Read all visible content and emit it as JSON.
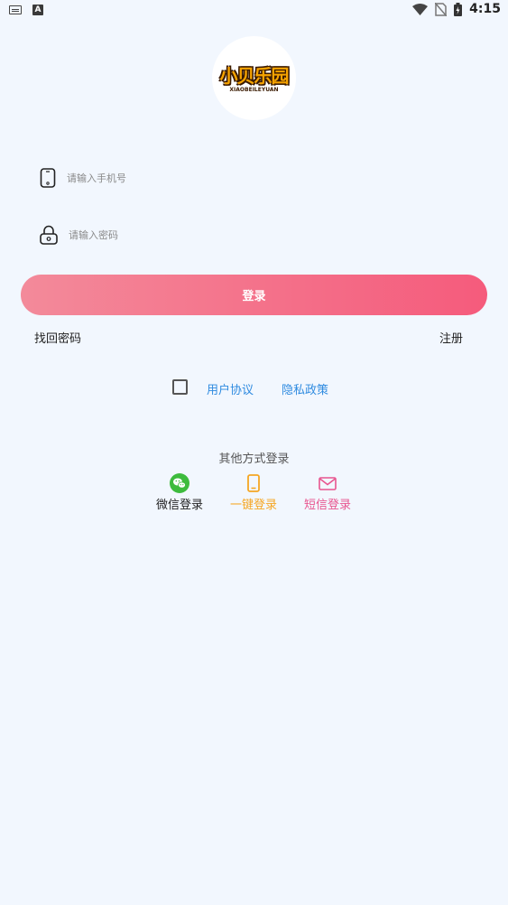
{
  "status_bar": {
    "time": "4:15",
    "left_icons": [
      "keyboard-icon",
      "a-letter-icon"
    ],
    "right_icons": [
      "wifi-icon",
      "no-sim-icon",
      "battery-icon"
    ]
  },
  "logo": {
    "main_text": "小贝乐园",
    "sub_text": "XIAOBEILEYUAN"
  },
  "form": {
    "phone_placeholder": "请输入手机号",
    "password_placeholder": "请输入密码",
    "phone_value": "",
    "password_value": "",
    "login_label": "登录"
  },
  "links": {
    "forgot_password": "找回密码",
    "register": "注册"
  },
  "agreement": {
    "checked": false,
    "user_agreement": "用户协议",
    "privacy_policy": "隐私政策"
  },
  "other_login": {
    "title": "其他方式登录",
    "methods": [
      {
        "label": "微信登录",
        "icon": "wechat-icon",
        "color": "#222222",
        "icon_color": "#3dbb3d"
      },
      {
        "label": "一键登录",
        "icon": "phone-icon",
        "color": "#f5a623",
        "icon_color": "#f5a623"
      },
      {
        "label": "短信登录",
        "icon": "mail-icon",
        "color": "#e8558f",
        "icon_color": "#e8558f"
      }
    ]
  },
  "colors": {
    "background": "#f2f7fe",
    "button_gradient_start": "#f38a9a",
    "button_gradient_end": "#f55b7c",
    "link_blue": "#2f8be0"
  }
}
